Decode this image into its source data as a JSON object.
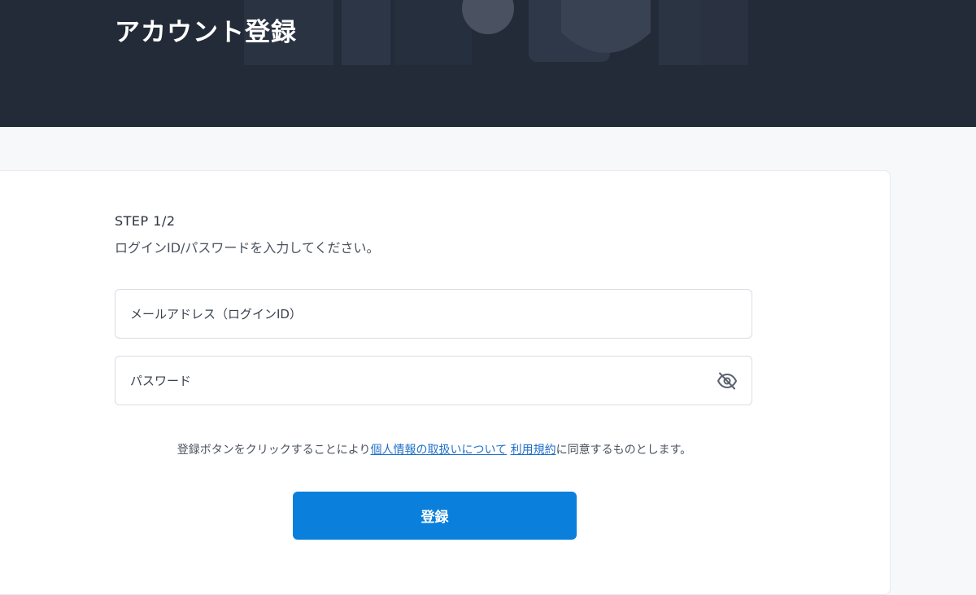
{
  "header": {
    "title": "アカウント登録"
  },
  "form": {
    "step_label": "STEP 1/2",
    "instruction": "ログインID/パスワードを入力してください。",
    "email": {
      "value": "",
      "placeholder": "メールアドレス（ログインID）"
    },
    "password": {
      "value": "",
      "placeholder": "パスワード",
      "toggle_icon": "eye-off-icon"
    },
    "consent": {
      "prefix": "登録ボタンをクリックすることにより",
      "privacy_link": "個人情報の取扱いについて",
      "separator": " ",
      "terms_link": "利用規約",
      "suffix": "に同意するものとします。"
    },
    "submit_label": "登録"
  },
  "colors": {
    "hero_bg": "#232b38",
    "primary": "#0a7fdc",
    "link": "#1f6fc8"
  }
}
